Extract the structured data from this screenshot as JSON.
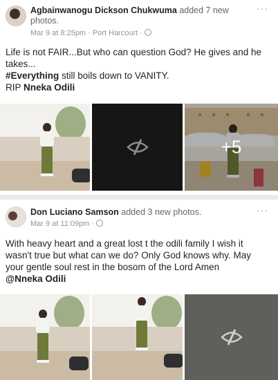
{
  "post1": {
    "author": "Agbainwanogu Dickson Chukwuma",
    "action": "added 7 new photos.",
    "time": "Mar 9 at 8:25pm",
    "sep": "·",
    "location": "Port Harcourt",
    "text_line1": "Life is not FAIR...But who can question God? He gives and he takes...",
    "hashtag": "#Everything",
    "text_line2_rest": " still boils down to VANITY.",
    "rip_prefix": "RIP ",
    "rip_name": "Nneka Odili",
    "more_count": "+5"
  },
  "post2": {
    "author": "Don Luciano Samson",
    "action": "added 3 new photos.",
    "time": "Mar 9 at 11:09pm",
    "sep": "·",
    "text": "With heavy heart and a great lost t the odili family I wish it wasn't true but what can we do? Only God knows why. May your gentle soul rest in the bosom of the Lord Amen",
    "mention": "@Nneka Odili"
  },
  "icons": {
    "more": "more-options-icon",
    "globe": "globe-icon",
    "hidden": "hidden-photo-icon"
  },
  "colors": {
    "name": "#1d2129",
    "meta": "#90949c",
    "page_bg": "#e9ebee"
  },
  "more_glyph": "···"
}
